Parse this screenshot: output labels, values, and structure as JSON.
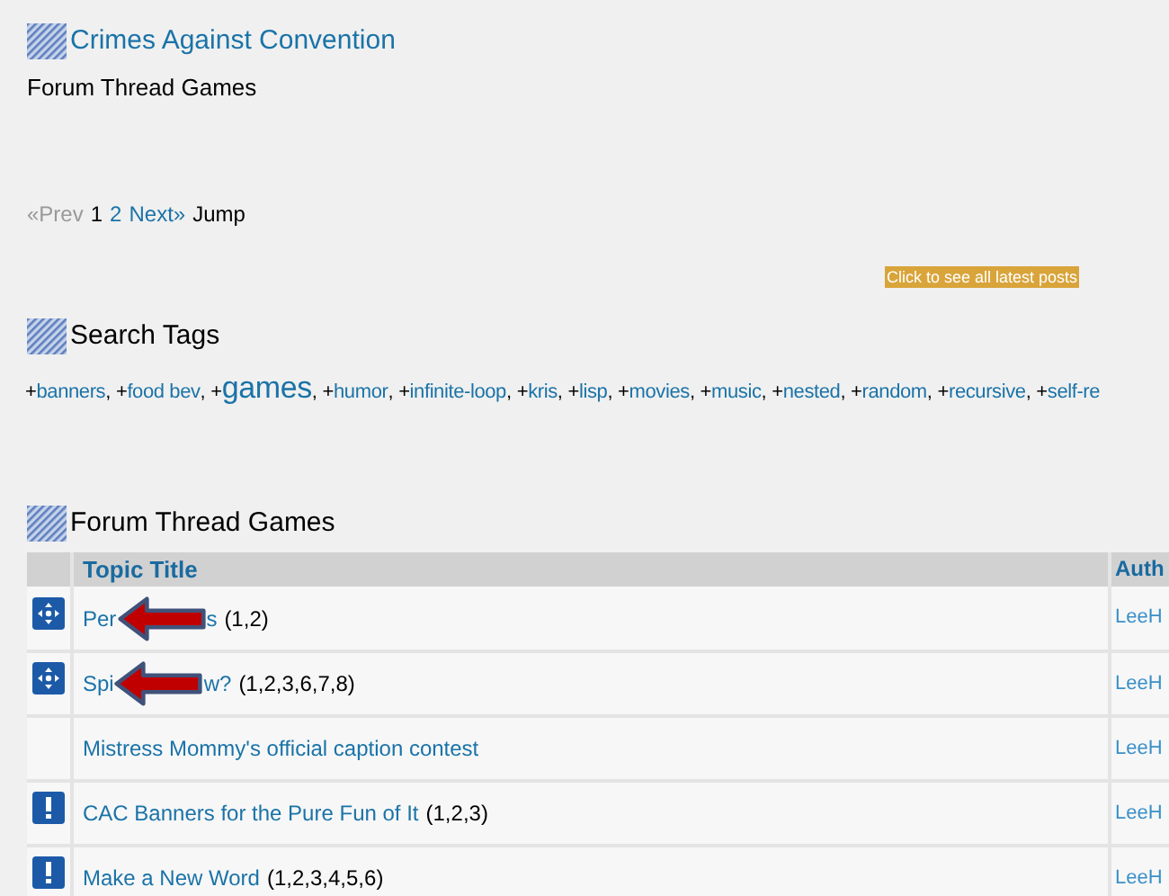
{
  "header": {
    "title": "Crimes Against Convention",
    "subtitle": "Forum Thread Games"
  },
  "pagination": [
    {
      "label": "«Prev",
      "kind": "disabled"
    },
    {
      "label": "1",
      "kind": "current"
    },
    {
      "label": "2",
      "kind": "link"
    },
    {
      "label": "Next»",
      "kind": "link"
    },
    {
      "label": "Jump",
      "kind": "plain"
    }
  ],
  "latest_posts_button": "Click to see all latest posts",
  "search_tags": {
    "title": "Search Tags",
    "tags": [
      {
        "plus": "+",
        "label": "banners",
        "separator": ",",
        "kind": "normal"
      },
      {
        "plus": "+",
        "label": "food bev",
        "separator": ",",
        "kind": "normal"
      },
      {
        "plus": "+",
        "label": "games",
        "separator": ",",
        "kind": "large"
      },
      {
        "plus": "+",
        "label": "humor",
        "separator": ",",
        "kind": "normal"
      },
      {
        "plus": "+",
        "label": "infinite-loop",
        "separator": ",",
        "kind": "normal"
      },
      {
        "plus": "+",
        "label": "kris",
        "separator": ",",
        "kind": "normal"
      },
      {
        "plus": "+",
        "label": "lisp",
        "separator": ",",
        "kind": "normal"
      },
      {
        "plus": "+",
        "label": "movies",
        "separator": ",",
        "kind": "normal"
      },
      {
        "plus": "+",
        "label": "music",
        "separator": ",",
        "kind": "normal"
      },
      {
        "plus": "+",
        "label": "nested",
        "separator": ",",
        "kind": "normal"
      },
      {
        "plus": "+",
        "label": "random",
        "separator": ",",
        "kind": "normal"
      },
      {
        "plus": "+",
        "label": "recursive",
        "separator": ",",
        "kind": "normal"
      },
      {
        "plus": "+",
        "label": "self-re",
        "kind": "normal"
      }
    ]
  },
  "table": {
    "title": "Forum Thread Games",
    "columns": [
      "Topic Title",
      "Auth"
    ],
    "rows": [
      {
        "kind": "move",
        "title": "Per",
        "title_end": "s",
        "pages": "(1,2)",
        "author": "LeeH",
        "arrow": true
      },
      {
        "kind": "move",
        "title": "Spi",
        "title_end": "w?",
        "pages": "(1,2,3,6,7,8)",
        "author": "LeeH",
        "arrow": true
      },
      {
        "kind": "none",
        "title": "Mistress Mommy's official caption contest",
        "author": "LeeH",
        "arrow": false
      },
      {
        "kind": "alert",
        "title": "CAC Banners for the Pure Fun of It",
        "pages": "(1,2,3)",
        "author": "LeeH",
        "arrow": false
      },
      {
        "kind": "alert",
        "title": "Make a New Word",
        "pages": "(1,2,3,4,5,6)",
        "author": "LeeH",
        "arrow": false
      }
    ]
  }
}
